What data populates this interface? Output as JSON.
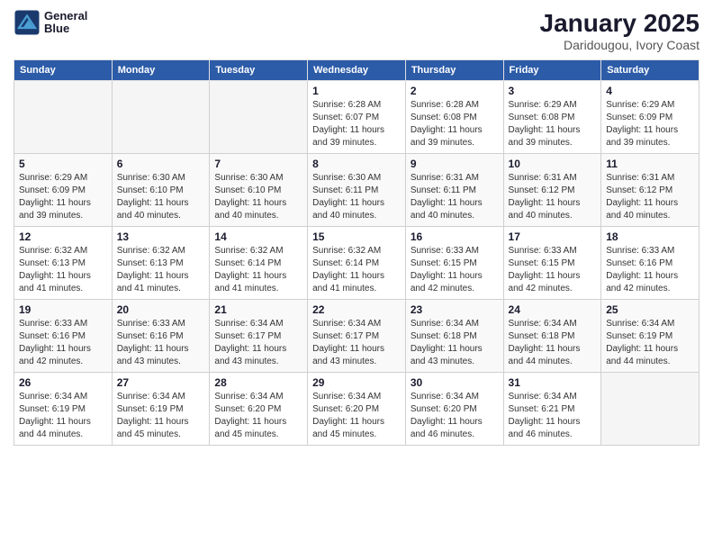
{
  "header": {
    "logo_line1": "General",
    "logo_line2": "Blue",
    "month_title": "January 2025",
    "subtitle": "Daridougou, Ivory Coast"
  },
  "weekdays": [
    "Sunday",
    "Monday",
    "Tuesday",
    "Wednesday",
    "Thursday",
    "Friday",
    "Saturday"
  ],
  "weeks": [
    [
      {
        "day": "",
        "info": ""
      },
      {
        "day": "",
        "info": ""
      },
      {
        "day": "",
        "info": ""
      },
      {
        "day": "1",
        "info": "Sunrise: 6:28 AM\nSunset: 6:07 PM\nDaylight: 11 hours\nand 39 minutes."
      },
      {
        "day": "2",
        "info": "Sunrise: 6:28 AM\nSunset: 6:08 PM\nDaylight: 11 hours\nand 39 minutes."
      },
      {
        "day": "3",
        "info": "Sunrise: 6:29 AM\nSunset: 6:08 PM\nDaylight: 11 hours\nand 39 minutes."
      },
      {
        "day": "4",
        "info": "Sunrise: 6:29 AM\nSunset: 6:09 PM\nDaylight: 11 hours\nand 39 minutes."
      }
    ],
    [
      {
        "day": "5",
        "info": "Sunrise: 6:29 AM\nSunset: 6:09 PM\nDaylight: 11 hours\nand 39 minutes."
      },
      {
        "day": "6",
        "info": "Sunrise: 6:30 AM\nSunset: 6:10 PM\nDaylight: 11 hours\nand 40 minutes."
      },
      {
        "day": "7",
        "info": "Sunrise: 6:30 AM\nSunset: 6:10 PM\nDaylight: 11 hours\nand 40 minutes."
      },
      {
        "day": "8",
        "info": "Sunrise: 6:30 AM\nSunset: 6:11 PM\nDaylight: 11 hours\nand 40 minutes."
      },
      {
        "day": "9",
        "info": "Sunrise: 6:31 AM\nSunset: 6:11 PM\nDaylight: 11 hours\nand 40 minutes."
      },
      {
        "day": "10",
        "info": "Sunrise: 6:31 AM\nSunset: 6:12 PM\nDaylight: 11 hours\nand 40 minutes."
      },
      {
        "day": "11",
        "info": "Sunrise: 6:31 AM\nSunset: 6:12 PM\nDaylight: 11 hours\nand 40 minutes."
      }
    ],
    [
      {
        "day": "12",
        "info": "Sunrise: 6:32 AM\nSunset: 6:13 PM\nDaylight: 11 hours\nand 41 minutes."
      },
      {
        "day": "13",
        "info": "Sunrise: 6:32 AM\nSunset: 6:13 PM\nDaylight: 11 hours\nand 41 minutes."
      },
      {
        "day": "14",
        "info": "Sunrise: 6:32 AM\nSunset: 6:14 PM\nDaylight: 11 hours\nand 41 minutes."
      },
      {
        "day": "15",
        "info": "Sunrise: 6:32 AM\nSunset: 6:14 PM\nDaylight: 11 hours\nand 41 minutes."
      },
      {
        "day": "16",
        "info": "Sunrise: 6:33 AM\nSunset: 6:15 PM\nDaylight: 11 hours\nand 42 minutes."
      },
      {
        "day": "17",
        "info": "Sunrise: 6:33 AM\nSunset: 6:15 PM\nDaylight: 11 hours\nand 42 minutes."
      },
      {
        "day": "18",
        "info": "Sunrise: 6:33 AM\nSunset: 6:16 PM\nDaylight: 11 hours\nand 42 minutes."
      }
    ],
    [
      {
        "day": "19",
        "info": "Sunrise: 6:33 AM\nSunset: 6:16 PM\nDaylight: 11 hours\nand 42 minutes."
      },
      {
        "day": "20",
        "info": "Sunrise: 6:33 AM\nSunset: 6:16 PM\nDaylight: 11 hours\nand 43 minutes."
      },
      {
        "day": "21",
        "info": "Sunrise: 6:34 AM\nSunset: 6:17 PM\nDaylight: 11 hours\nand 43 minutes."
      },
      {
        "day": "22",
        "info": "Sunrise: 6:34 AM\nSunset: 6:17 PM\nDaylight: 11 hours\nand 43 minutes."
      },
      {
        "day": "23",
        "info": "Sunrise: 6:34 AM\nSunset: 6:18 PM\nDaylight: 11 hours\nand 43 minutes."
      },
      {
        "day": "24",
        "info": "Sunrise: 6:34 AM\nSunset: 6:18 PM\nDaylight: 11 hours\nand 44 minutes."
      },
      {
        "day": "25",
        "info": "Sunrise: 6:34 AM\nSunset: 6:19 PM\nDaylight: 11 hours\nand 44 minutes."
      }
    ],
    [
      {
        "day": "26",
        "info": "Sunrise: 6:34 AM\nSunset: 6:19 PM\nDaylight: 11 hours\nand 44 minutes."
      },
      {
        "day": "27",
        "info": "Sunrise: 6:34 AM\nSunset: 6:19 PM\nDaylight: 11 hours\nand 45 minutes."
      },
      {
        "day": "28",
        "info": "Sunrise: 6:34 AM\nSunset: 6:20 PM\nDaylight: 11 hours\nand 45 minutes."
      },
      {
        "day": "29",
        "info": "Sunrise: 6:34 AM\nSunset: 6:20 PM\nDaylight: 11 hours\nand 45 minutes."
      },
      {
        "day": "30",
        "info": "Sunrise: 6:34 AM\nSunset: 6:20 PM\nDaylight: 11 hours\nand 46 minutes."
      },
      {
        "day": "31",
        "info": "Sunrise: 6:34 AM\nSunset: 6:21 PM\nDaylight: 11 hours\nand 46 minutes."
      },
      {
        "day": "",
        "info": ""
      }
    ]
  ]
}
